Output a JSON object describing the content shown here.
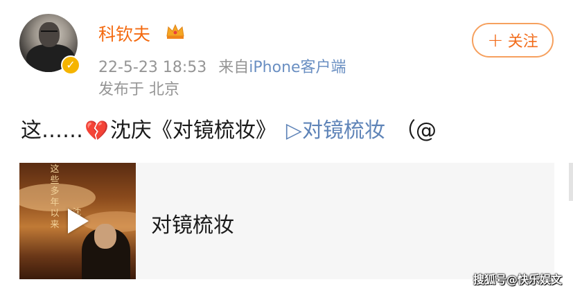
{
  "post": {
    "author": {
      "name": "科钦夫",
      "verified": true
    },
    "meta": {
      "time": "22-5-23 18:53",
      "source_prefix": "来自",
      "source": "iPhone客户端",
      "location": "发布于 北京"
    },
    "follow_button": {
      "plus": "+",
      "label": "关注"
    },
    "text": {
      "lead": "这……",
      "heart": "💔",
      "body": "沈庆《对镜梳妆》",
      "link": "▷对镜梳妆",
      "tail": "（@"
    },
    "card": {
      "title": "对镜梳妆",
      "cover_text_1": "这些多年以来",
      "cover_text_2": "沈庆"
    }
  },
  "watermark": "搜狐号@快乐娱文",
  "colors": {
    "username": "#f46a10",
    "link": "#5f84b8",
    "follow_border": "#f6a05e",
    "meta_gray": "#959595"
  }
}
